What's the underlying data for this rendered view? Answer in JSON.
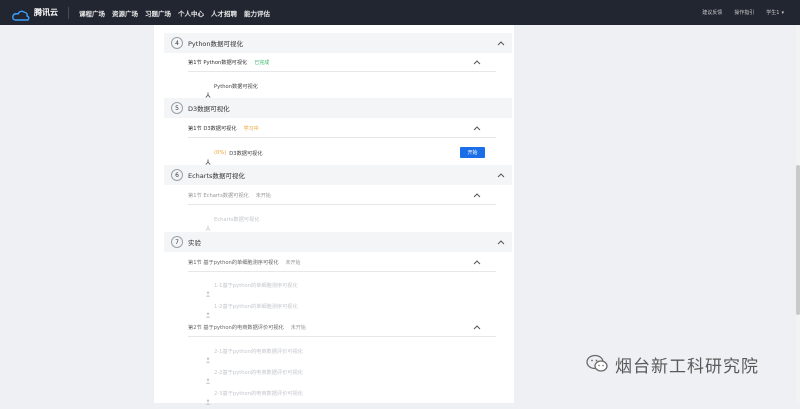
{
  "topbar": {
    "logo_text": "腾讯云",
    "nav": [
      "课程广场",
      "资源广场",
      "习题广场",
      "个人中心",
      "人才招聘",
      "能力评估"
    ],
    "right": {
      "item1": "建议反馈",
      "item2": "操作指引",
      "user": "学生1"
    }
  },
  "chapters": [
    {
      "num": "4",
      "title": "Python数据可视化",
      "sections": [
        {
          "label": "第1节 Python数据可视化",
          "status": "已完成",
          "status_color": "#3db86a",
          "items": [
            {
              "text": "Python数据可视化",
              "prefix": "",
              "greyed": false
            }
          ]
        }
      ]
    },
    {
      "num": "5",
      "title": "D3数据可视化",
      "sections": [
        {
          "label": "第1节 D3数据可视化",
          "status": "学习中",
          "status_color": "#f0a030",
          "items": [
            {
              "text": "D3数据可视化",
              "prefix": "(0%)",
              "greyed": false,
              "button": "开始"
            }
          ]
        }
      ]
    },
    {
      "num": "6",
      "title": "Echarts数据可视化",
      "sections": [
        {
          "label": "第1节 Echarts数据可视化",
          "status": "未开始",
          "status_color": "#999999",
          "items": [
            {
              "text": "Echarts数据可视化",
              "prefix": "",
              "greyed": true
            }
          ]
        }
      ]
    },
    {
      "num": "7",
      "title": "实验",
      "sections": [
        {
          "label": "第1节 基于python的单细胞测序可视化",
          "status": "未开始",
          "status_color": "#999999",
          "items": [
            {
              "text": "1-1基于python的单细胞测序可视化",
              "greyed": true
            },
            {
              "text": "1-2基于python的单细胞测序可视化",
              "greyed": true
            }
          ]
        },
        {
          "label": "第2节 基于python的电商数据评价可视化",
          "status": "未开始",
          "status_color": "#999999",
          "items": [
            {
              "text": "2-1基于python的电商数据评价可视化",
              "greyed": true
            },
            {
              "text": "2-2基于python的电商数据评价可视化",
              "greyed": true
            },
            {
              "text": "2-3基于python的电商数据评价可视化",
              "greyed": true
            }
          ]
        }
      ]
    }
  ],
  "watermark": "烟台新工科研究院",
  "colors": {
    "topbar": "#222631",
    "accent": "#1a6fe8"
  }
}
